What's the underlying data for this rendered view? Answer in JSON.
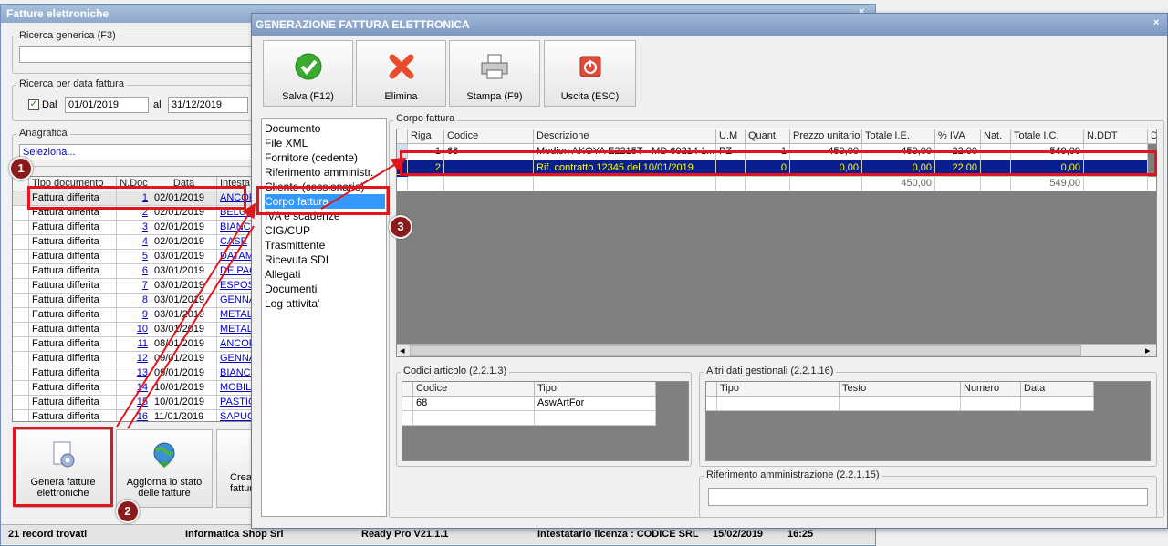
{
  "main": {
    "title": "Fatture elettroniche",
    "close": "×",
    "search_label": "Ricerca generica (F3)",
    "date_label": "Ricerca per data fattura",
    "dal_label": "Dal",
    "dal_value": "01/01/2019",
    "al_label": "al",
    "al_value": "31/12/2019",
    "anagrafica_label": "Anagrafica",
    "anagrafica_value": "Seleziona...",
    "columns": [
      "Tipo documento",
      "N.Doc",
      "Data",
      "Intesta"
    ],
    "rows": [
      [
        "Fattura differita",
        "1",
        "02/01/2019",
        "ANCOR"
      ],
      [
        "Fattura differita",
        "2",
        "02/01/2019",
        "BELUSO"
      ],
      [
        "Fattura differita",
        "3",
        "02/01/2019",
        "BIANCH"
      ],
      [
        "Fattura differita",
        "4",
        "02/01/2019",
        "CASE"
      ],
      [
        "Fattura differita",
        "5",
        "03/01/2019",
        "DATAMA"
      ],
      [
        "Fattura differita",
        "6",
        "03/01/2019",
        "DE PAO"
      ],
      [
        "Fattura differita",
        "7",
        "03/01/2019",
        "ESPOSI"
      ],
      [
        "Fattura differita",
        "8",
        "03/01/2019",
        "GENNA"
      ],
      [
        "Fattura differita",
        "9",
        "03/01/2019",
        "METALC"
      ],
      [
        "Fattura differita",
        "10",
        "03/01/2019",
        "METALL"
      ],
      [
        "Fattura differita",
        "11",
        "08/01/2019",
        "ANCOR"
      ],
      [
        "Fattura differita",
        "12",
        "09/01/2019",
        "GENNA"
      ],
      [
        "Fattura differita",
        "13",
        "09/01/2019",
        "BIANCH"
      ],
      [
        "Fattura differita",
        "14",
        "10/01/2019",
        "MOBILI"
      ],
      [
        "Fattura differita",
        "15",
        "10/01/2019",
        "PASTIC"
      ],
      [
        "Fattura differita",
        "16",
        "11/01/2019",
        "SAPUCO"
      ]
    ],
    "btn_genera": "Genera fatture elettroniche",
    "btn_aggiorna": "Aggiorna lo stato delle fatture",
    "btn_crea": "Crea fattura",
    "status": {
      "records": "21 record trovati",
      "company": "Informatica Shop Srl",
      "version": "Ready Pro V21.1.1",
      "license": "Intestatario licenza : CODICE SRL",
      "date": "15/02/2019",
      "time": "16:25"
    }
  },
  "dialog": {
    "title": "GENERAZIONE FATTURA ELETTRONICA",
    "close": "×",
    "toolbar": {
      "save": "Salva (F12)",
      "delete": "Elimina",
      "print": "Stampa (F9)",
      "exit": "Uscita (ESC)"
    },
    "nav": [
      "Documento",
      "File XML",
      "Fornitore (cedente)",
      "Riferimento amministr.",
      "Cliente (cessionario)",
      "Corpo fattura",
      "IVA e scadenze",
      "CIG/CUP",
      "Trasmittente",
      "Ricevuta SDI",
      "Allegati",
      "Documenti",
      "Log attivita'"
    ],
    "body_label": "Corpo fattura",
    "body_columns": [
      "Riga",
      "Codice",
      "Descrizione",
      "U.M",
      "Quant.",
      "Prezzo unitario",
      "Totale I.E.",
      "% IVA",
      "Nat.",
      "Totale I.C.",
      "N.DDT",
      "D"
    ],
    "body_rows": [
      [
        "1",
        "68",
        "Medion AKOYA E2215T - MD 60214 1...",
        "PZ",
        "1",
        "450,00",
        "450,00",
        "22,00",
        "",
        "549,00",
        ""
      ],
      [
        "2",
        "",
        "Rif. contratto 12345 del 10/01/2019",
        "",
        "0",
        "0,00",
        "0,00",
        "22,00",
        "",
        "0,00",
        ""
      ]
    ],
    "body_totals": [
      "450,00",
      "549,00"
    ],
    "codici_label": "Codici articolo (2.2.1.3)",
    "codici_columns": [
      "Codice",
      "Tipo"
    ],
    "codici_rows": [
      [
        "68",
        "AswArtFor"
      ]
    ],
    "altri_label": "Altri dati gestionali (2.2.1.16)",
    "altri_columns": [
      "Tipo",
      "Testo",
      "Numero",
      "Data"
    ],
    "rifamm_label": "Riferimento amministrazione (2.2.1.15)"
  },
  "annotations": [
    "1",
    "2",
    "3"
  ],
  "colors": {
    "highlight": "#e0161c",
    "selection": "#0a1f8f",
    "selection_text": "#ffff00",
    "nav_selected": "#3399ff"
  }
}
